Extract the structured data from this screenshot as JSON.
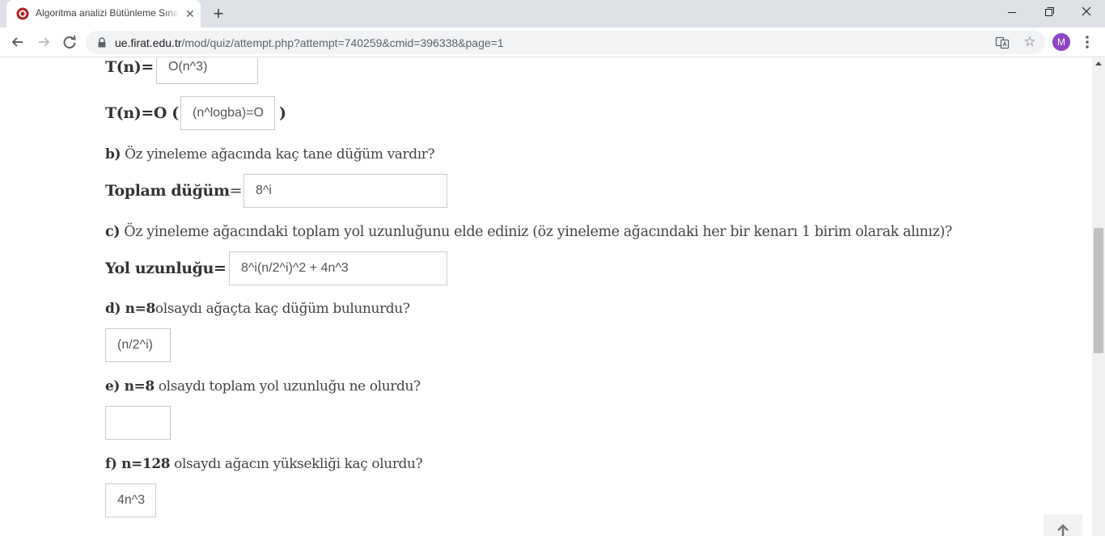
{
  "browser": {
    "tab_title": "Algoritma analizi Bütünleme Sınavı",
    "tab_close": "✕",
    "new_tab": "+",
    "url_host": "ue.firat.edu.tr",
    "url_path": "/mod/quiz/attempt.php?attempt=740259&cmid=396338&page=1",
    "avatar_letter": "M",
    "star": "☆",
    "avatar_color": "#8e44c4"
  },
  "quiz": {
    "tn_label": "T(n)=",
    "tn_answer": "O(n^3)",
    "tno_prefix": "T(n)=O (",
    "tno_answer": "(n^logba)=O",
    "tno_suffix": ")",
    "b_letter": "b)",
    "b_text": " Öz yineleme ağacında kaç tane düğüm vardır?",
    "b_label": "Toplam düğüm",
    "b_eq": "=",
    "b_answer": "8^i",
    "c_letter": "c)",
    "c_text": " Öz yineleme ağacındaki toplam yol uzunluğunu elde ediniz (öz yineleme ağacındaki her bir kenarı 1 birim olarak alınız)?",
    "c_label": "Yol uzunluğu=",
    "c_answer": "8^i(n/2^i)^2 + 4n^3",
    "d_letter": "d)",
    "d_bold": " n=8",
    "d_text": "olsaydı ağaçta kaç düğüm bulunurdu?",
    "d_answer": "(n/2^i)",
    "e_letter": "e)",
    "e_bold": " n=8",
    "e_text": " olsaydı toplam yol uzunluğu ne olurdu?",
    "e_answer": "",
    "f_letter": "f)",
    "f_bold": " n=128",
    "f_text": " olsaydı ağacın yüksekliği kaç olurdu?",
    "f_answer": "4n^3"
  }
}
